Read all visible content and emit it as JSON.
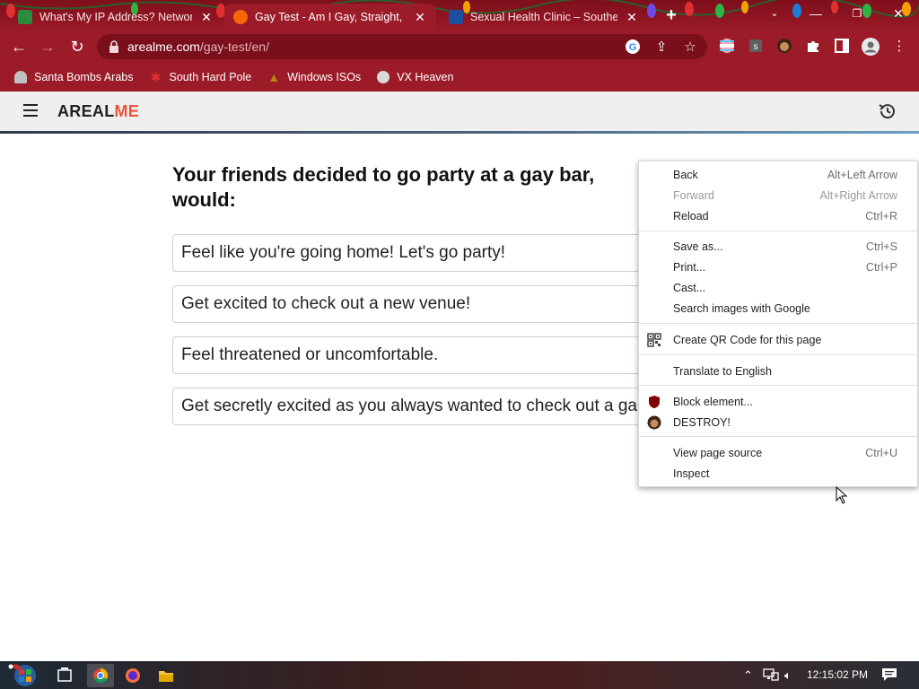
{
  "browser": {
    "tabs": [
      {
        "title": "What's My IP Address? Network",
        "active": false
      },
      {
        "title": "Gay Test - Am I Gay, Straight, or",
        "active": true
      },
      {
        "title": "Sexual Health Clinic – Southern",
        "active": false
      }
    ],
    "url_host": "arealme.com",
    "url_path": "/gay-test/en/",
    "bookmarks": [
      {
        "label": "Santa Bombs Arabs"
      },
      {
        "label": "South Hard Pole"
      },
      {
        "label": "Windows ISOs"
      },
      {
        "label": "VX Heaven"
      }
    ]
  },
  "site": {
    "logo_main": "AREAL",
    "logo_accent": "ME",
    "question": "Your friends decided to go party at a gay bar, would:",
    "answers": [
      "Feel like you're going home! Let's go party!",
      "Get excited to check out a new venue!",
      "Feel threatened or uncomfortable.",
      "Get secretly excited as you always wanted to check out a ga"
    ]
  },
  "context_menu": {
    "items": [
      {
        "label": "Back",
        "shortcut": "Alt+Left Arrow"
      },
      {
        "label": "Forward",
        "shortcut": "Alt+Right Arrow",
        "disabled": true
      },
      {
        "label": "Reload",
        "shortcut": "Ctrl+R"
      },
      {
        "label": "Save as...",
        "shortcut": "Ctrl+S"
      },
      {
        "label": "Print...",
        "shortcut": "Ctrl+P"
      },
      {
        "label": "Cast..."
      },
      {
        "label": "Search images with Google"
      },
      {
        "label": "Create QR Code for this page"
      },
      {
        "label": "Translate to English"
      },
      {
        "label": "Block element..."
      },
      {
        "label": "DESTROY!"
      },
      {
        "label": "View page source",
        "shortcut": "Ctrl+U"
      },
      {
        "label": "Inspect"
      }
    ]
  },
  "taskbar": {
    "clock": "12:15:02 PM"
  },
  "colors": {
    "chrome_theme": "#9b1b29",
    "logo_accent": "#e8553d",
    "header_bar": "#efefef"
  }
}
